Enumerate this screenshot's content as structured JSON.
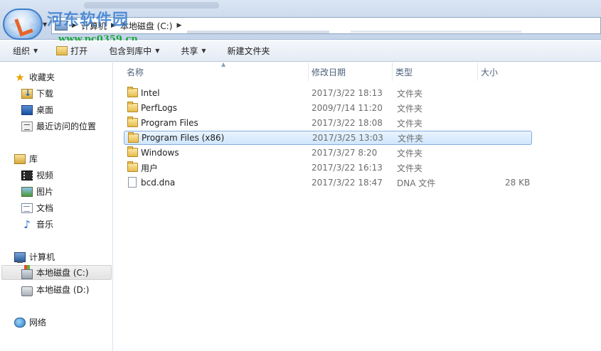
{
  "window": {
    "breadcrumbs": [
      "计算机",
      "本地磁盘 (C:)"
    ]
  },
  "watermark": {
    "title": "河东软件园",
    "url": "www.pc0359.cn"
  },
  "toolbar": {
    "organize_label": "组织",
    "open_label": "打开",
    "include_in_library_label": "包含到库中",
    "share_label": "共享",
    "new_folder_label": "新建文件夹"
  },
  "navpane": {
    "favorites": {
      "label": "收藏夹",
      "items": [
        "下载",
        "桌面",
        "最近访问的位置"
      ]
    },
    "libraries": {
      "label": "库",
      "items": [
        "视频",
        "图片",
        "文档",
        "音乐"
      ]
    },
    "computer": {
      "label": "计算机",
      "items": [
        "本地磁盘 (C:)",
        "本地磁盘 (D:)"
      ],
      "selected": "本地磁盘 (C:)"
    },
    "network": {
      "label": "网络"
    }
  },
  "filelist": {
    "columns": {
      "name": "名称",
      "modified": "修改日期",
      "type": "类型",
      "size": "大小"
    },
    "sort_column": "名称",
    "rows": [
      {
        "name": "Intel",
        "modified": "2017/3/22 18:13",
        "type": "文件夹",
        "size": "",
        "icon": "folder-icon"
      },
      {
        "name": "PerfLogs",
        "modified": "2009/7/14 11:20",
        "type": "文件夹",
        "size": "",
        "icon": "folder-icon"
      },
      {
        "name": "Program Files",
        "modified": "2017/3/22 18:08",
        "type": "文件夹",
        "size": "",
        "icon": "folder-icon"
      },
      {
        "name": "Program Files (x86)",
        "modified": "2017/3/25 13:03",
        "type": "文件夹",
        "size": "",
        "icon": "folder-icon",
        "selected": true
      },
      {
        "name": "Windows",
        "modified": "2017/3/27 8:20",
        "type": "文件夹",
        "size": "",
        "icon": "folder-icon"
      },
      {
        "name": "用户",
        "modified": "2017/3/22 16:13",
        "type": "文件夹",
        "size": "",
        "icon": "folder-icon"
      },
      {
        "name": "bcd.dna",
        "modified": "2017/3/22 18:47",
        "type": "DNA 文件",
        "size": "28 KB",
        "icon": "file-icon"
      }
    ]
  },
  "colors": {
    "selection_fill": "#cfe6fc",
    "selection_border": "#84acdd",
    "header_text": "#4c607a",
    "secondary_text": "#6d6d6d"
  }
}
